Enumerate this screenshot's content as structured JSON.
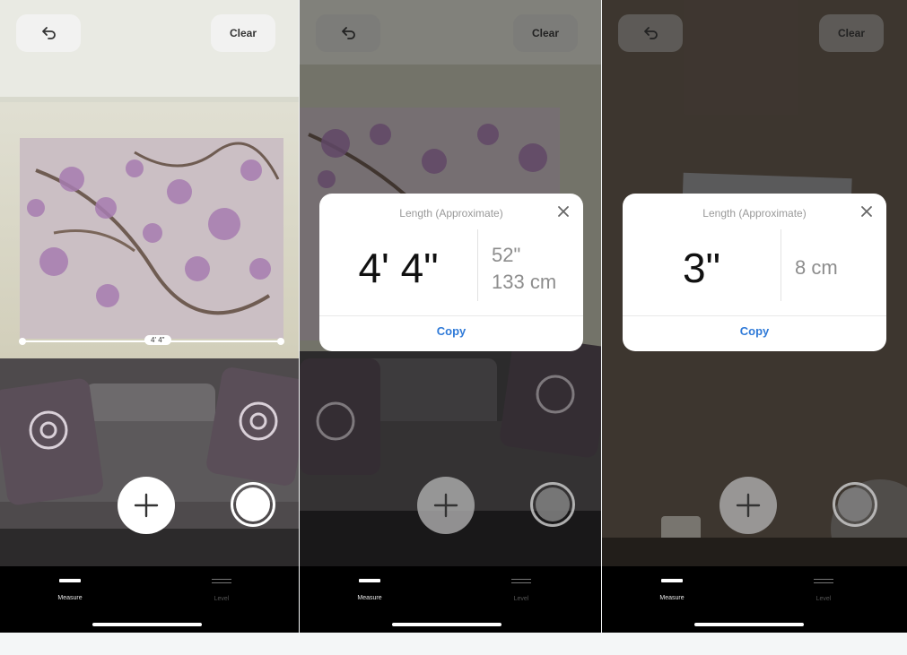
{
  "screens": [
    {
      "top_bar": {
        "undo_icon": "undo-arrow-icon",
        "clear_label": "Clear"
      },
      "measurement_label": "4' 4\"",
      "controls": {
        "add_icon": "plus-icon",
        "capture_icon": "capture-circle-icon"
      },
      "tabs": [
        {
          "label": "Measure",
          "icon": "measure-icon"
        },
        {
          "label": "Level",
          "icon": "level-icon"
        }
      ]
    },
    {
      "top_bar": {
        "undo_icon": "undo-arrow-icon",
        "clear_label": "Clear"
      },
      "card": {
        "title": "Length (Approximate)",
        "close_icon": "close-icon",
        "main_value": "4' 4\"",
        "alt_value_1": "52\"",
        "alt_value_2": "133 cm",
        "copy_label": "Copy"
      },
      "controls": {
        "add_icon": "plus-icon",
        "capture_icon": "capture-circle-icon"
      },
      "tabs": [
        {
          "label": "Measure",
          "icon": "measure-icon"
        },
        {
          "label": "Level",
          "icon": "level-icon"
        }
      ]
    },
    {
      "top_bar": {
        "undo_icon": "undo-arrow-icon",
        "clear_label": "Clear"
      },
      "card": {
        "title": "Length (Approximate)",
        "close_icon": "close-icon",
        "main_value": "3\"",
        "alt_value_1": "8 cm",
        "copy_label": "Copy"
      },
      "controls": {
        "add_icon": "plus-icon",
        "capture_icon": "capture-circle-icon"
      },
      "tabs": [
        {
          "label": "Measure",
          "icon": "measure-icon"
        },
        {
          "label": "Level",
          "icon": "level-icon"
        }
      ]
    }
  ],
  "colors": {
    "accent": "#2f7ad8",
    "tab_bar": "#000000",
    "card": "#ffffff"
  }
}
